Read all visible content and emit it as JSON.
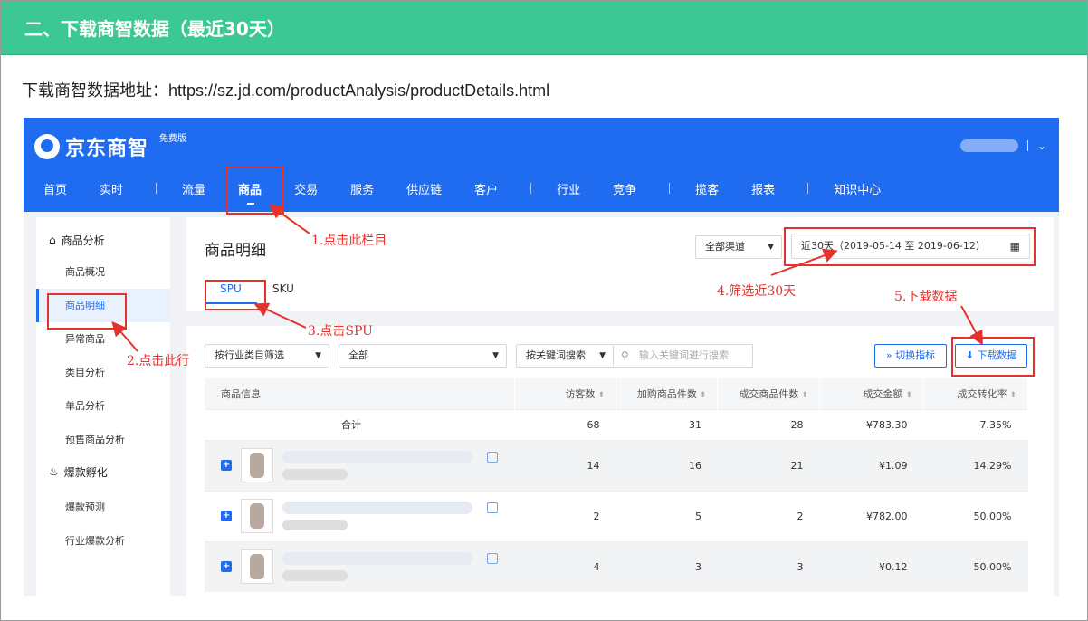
{
  "header": {
    "title": "二、下载商智数据（最近30天）"
  },
  "intro": {
    "label": "下载商智数据地址：",
    "url": "https://sz.jd.com/productAnalysis/productDetails.html"
  },
  "app": {
    "logo": "京东商智",
    "badge": "免费版",
    "nav": [
      "首页",
      "实时",
      "流量",
      "商品",
      "交易",
      "服务",
      "供应链",
      "客户",
      "行业",
      "竞争",
      "揽客",
      "报表",
      "知识中心"
    ],
    "sidebar": {
      "group1": "商品分析",
      "items1": [
        "商品概况",
        "商品明细",
        "异常商品",
        "类目分析",
        "单品分析",
        "预售商品分析"
      ],
      "group2": "爆款孵化",
      "items2": [
        "爆款预测",
        "行业爆款分析"
      ]
    },
    "main": {
      "title": "商品明细",
      "channel": "全部渠道",
      "date_range": "近30天（2019-05-14 至 2019-06-12）",
      "tabs": [
        "SPU",
        "SKU"
      ]
    },
    "filters": {
      "category_select": "按行业类目筛选",
      "all_select": "全部",
      "keyword_select": "按关键词搜索",
      "keyword_placeholder": "输入关键词进行搜索",
      "switch_button": "切换指标",
      "download_button": "下载数据"
    },
    "table": {
      "columns": [
        "商品信息",
        "访客数",
        "加购商品件数",
        "成交商品件数",
        "成交金额",
        "成交转化率"
      ],
      "total": {
        "label": "合计",
        "values": [
          "68",
          "31",
          "28",
          "¥783.30",
          "7.35%"
        ]
      },
      "rows": [
        {
          "values": [
            "14",
            "16",
            "21",
            "¥1.09",
            "14.29%"
          ]
        },
        {
          "values": [
            "2",
            "5",
            "2",
            "¥782.00",
            "50.00%"
          ]
        },
        {
          "values": [
            "4",
            "3",
            "3",
            "¥0.12",
            "50.00%"
          ]
        }
      ]
    }
  },
  "annotations": {
    "a1": "1.点击此栏目",
    "a2": "2.点击此行",
    "a3": "3.点击SPU",
    "a4": "4.筛选近30天",
    "a5": "5.下载数据"
  },
  "colors": {
    "header_green": "#3cc894",
    "app_blue": "#1f6cf0",
    "annotation_red": "#e5322d"
  }
}
